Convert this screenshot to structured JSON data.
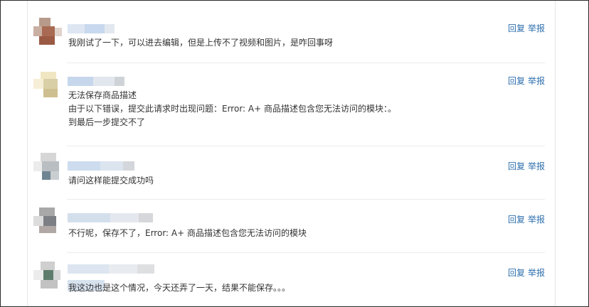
{
  "actions": {
    "reply_label": "回复",
    "report_label": "举报"
  },
  "comments": [
    {
      "lines": [
        "我刚试了一下，可以进去编辑，但是上传不了视频和图片，是咋回事呀"
      ]
    },
    {
      "lines": [
        "无法保存商品描述",
        "由于以下错误，提交此请求时出现问题：Error: A+ 商品描述包含您无法访问的模块：。",
        "到最后一步提交不了"
      ]
    },
    {
      "lines": [
        "请问这样能提交成功吗"
      ]
    },
    {
      "lines": [
        "不行呢，保存不了，Error: A+ 商品描述包含您无法访问的模块"
      ]
    },
    {
      "lines": [
        "我这边也是这个情况，今天还弄了一天，结果不能保存。。。"
      ]
    }
  ],
  "colors": {
    "link": "#2e6fad",
    "text": "#333333",
    "divider": "#ececec"
  }
}
